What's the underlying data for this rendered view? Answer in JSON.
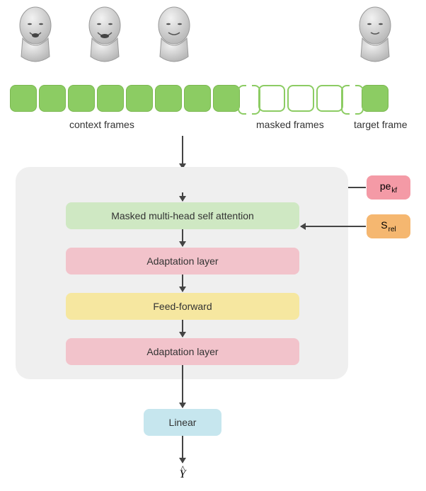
{
  "diagram": {
    "heads_count": 4,
    "frame_labels": {
      "context": "context frames",
      "masked": "masked frames",
      "target": "target frame"
    },
    "plus_symbol": "⊕",
    "inputs": {
      "pe": {
        "base": "pe",
        "sub": "kf"
      },
      "srel": {
        "base": "S",
        "sub": "rel"
      }
    },
    "layers": {
      "mha": "Masked multi-head self attention",
      "adapt1": "Adaptation layer",
      "ff": "Feed-forward",
      "adapt2": "Adaptation layer",
      "linear": "Linear"
    },
    "output": {
      "symbol": "Y",
      "hat": "^"
    },
    "frame_tokens": {
      "context_filled": 8,
      "masked_empty": 3,
      "target_filled": 1,
      "show_continuation_gap": true
    }
  }
}
